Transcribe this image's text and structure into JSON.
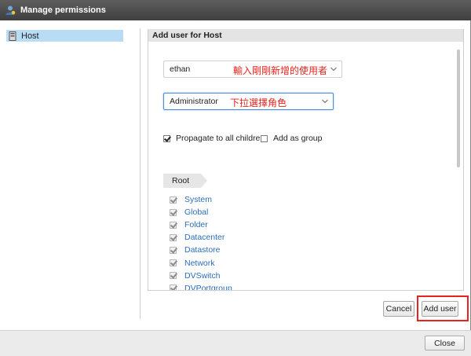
{
  "window": {
    "title": "Manage permissions"
  },
  "sidebar": {
    "items": [
      {
        "label": "Host"
      }
    ]
  },
  "panel": {
    "header": "Add user for Host",
    "user_select": {
      "value": "ethan",
      "annotation": "輸入剛剛新增的使用者"
    },
    "role_select": {
      "value": "Administrator",
      "annotation": "下拉選擇角色"
    },
    "propagate": {
      "label": "Propagate to all children",
      "checked": true
    },
    "add_as_group": {
      "label": "Add as group",
      "checked": false
    },
    "root_label": "Root",
    "privileges": [
      {
        "label": "System",
        "checked": true
      },
      {
        "label": "Global",
        "checked": true
      },
      {
        "label": "Folder",
        "checked": true
      },
      {
        "label": "Datacenter",
        "checked": true
      },
      {
        "label": "Datastore",
        "checked": true
      },
      {
        "label": "Network",
        "checked": true
      },
      {
        "label": "DVSwitch",
        "checked": true
      },
      {
        "label": "DVPortgroup",
        "checked": true
      }
    ]
  },
  "buttons": {
    "cancel": "Cancel",
    "add_user": "Add user",
    "close": "Close"
  },
  "colors": {
    "highlight": "#e8231e",
    "link": "#2a6ebb",
    "selected": "#b9dcf5"
  }
}
